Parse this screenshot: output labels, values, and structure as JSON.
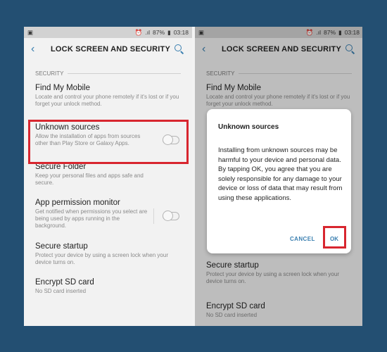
{
  "status": {
    "battery": "87%",
    "time": "03:18"
  },
  "appbar": {
    "title": "LOCK SCREEN AND SECURITY"
  },
  "section": {
    "label": "SECURITY"
  },
  "items": [
    {
      "title": "Find My Mobile",
      "subtitle": "Locate and control your phone remotely if it's lost or if you forget your unlock method."
    },
    {
      "title": "Unknown sources",
      "subtitle": "Allow the installation of apps from sources other than Play Store or Galaxy Apps.",
      "toggle": "off"
    },
    {
      "title": "Secure Folder",
      "subtitle": "Keep your personal files and apps safe and secure."
    },
    {
      "title": "App permission monitor",
      "subtitle": "Get notified when permissions you select are being used by apps running in the background.",
      "toggle": "off"
    },
    {
      "title": "Secure startup",
      "subtitle": "Protect your device by using a screen lock when your device turns on."
    },
    {
      "title": "Encrypt SD card",
      "subtitle": "No SD card inserted"
    }
  ],
  "dialog": {
    "title": "Unknown sources",
    "body": "Installing from unknown sources may be harmful to your device and personal data. By tapping OK, you agree that you are solely responsible for any damage to your device or loss of data that may result from using these applications.",
    "cancel": "CANCEL",
    "ok": "OK"
  },
  "colors": {
    "background": "#234f72",
    "accent": "#3a7fb0",
    "highlight": "#d8262f"
  }
}
